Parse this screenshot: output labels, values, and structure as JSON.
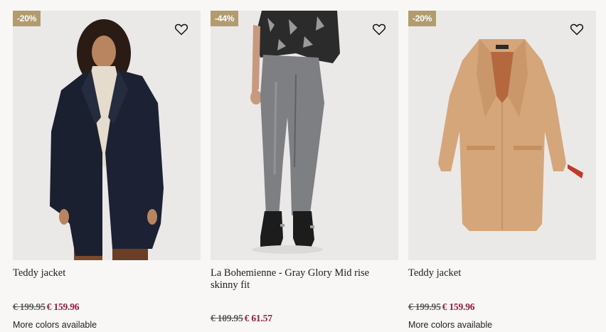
{
  "products": [
    {
      "badge": "-20%",
      "name": "Teddy jacket",
      "old_price": "€ 199.95",
      "new_price": "€ 159.96",
      "more_colors": "More colors available",
      "image": "woman-navy-teddy-coat"
    },
    {
      "badge": "-44%",
      "name": "La Bohemienne - Gray Glory Mid rise skinny fit",
      "old_price": "€ 109.95",
      "new_price": "€ 61.57",
      "image": "grey-skinny-jeans-black-boots"
    },
    {
      "badge": "-20%",
      "name": "Teddy jacket",
      "old_price": "€ 199.95",
      "new_price": "€ 159.96",
      "more_colors": "More colors available",
      "image": "camel-teddy-coat"
    }
  ],
  "icons": {
    "wishlist": "heart-outline-icon"
  },
  "colors": {
    "badge": "#b29b6d",
    "sale_price": "#9a1c3a",
    "background": "#f9f7f6"
  }
}
